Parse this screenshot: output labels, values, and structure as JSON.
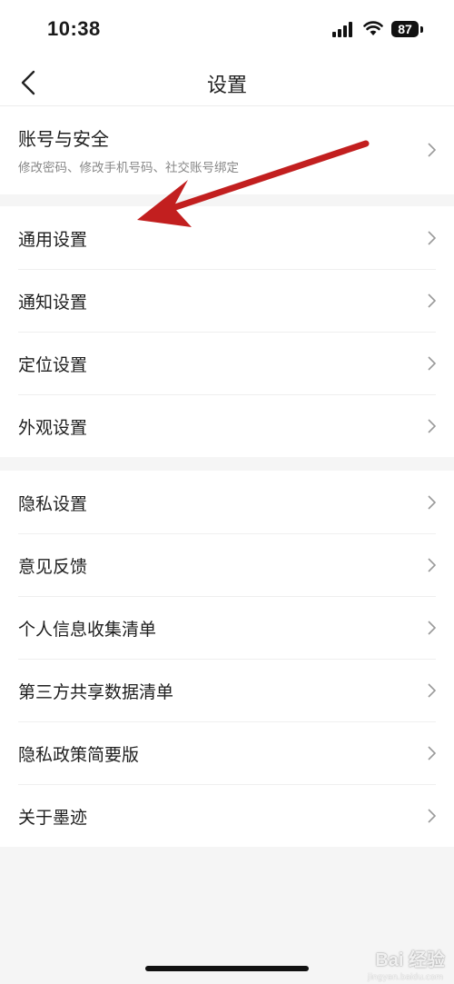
{
  "status_bar": {
    "time": "10:38",
    "battery": "87"
  },
  "nav": {
    "title": "设置"
  },
  "account": {
    "title": "账号与安全",
    "subtitle": "修改密码、修改手机号码、社交账号绑定"
  },
  "group1": [
    {
      "label": "通用设置"
    },
    {
      "label": "通知设置"
    },
    {
      "label": "定位设置"
    },
    {
      "label": "外观设置"
    }
  ],
  "group2": [
    {
      "label": "隐私设置"
    },
    {
      "label": "意见反馈"
    },
    {
      "label": "个人信息收集清单"
    },
    {
      "label": "第三方共享数据清单"
    },
    {
      "label": "隐私政策简要版"
    },
    {
      "label": "关于墨迹"
    }
  ],
  "annotation": {
    "arrow_color": "#c21f1f"
  },
  "watermark": {
    "text": "Bai 经验",
    "sub": "jingyan.baidu.com"
  }
}
